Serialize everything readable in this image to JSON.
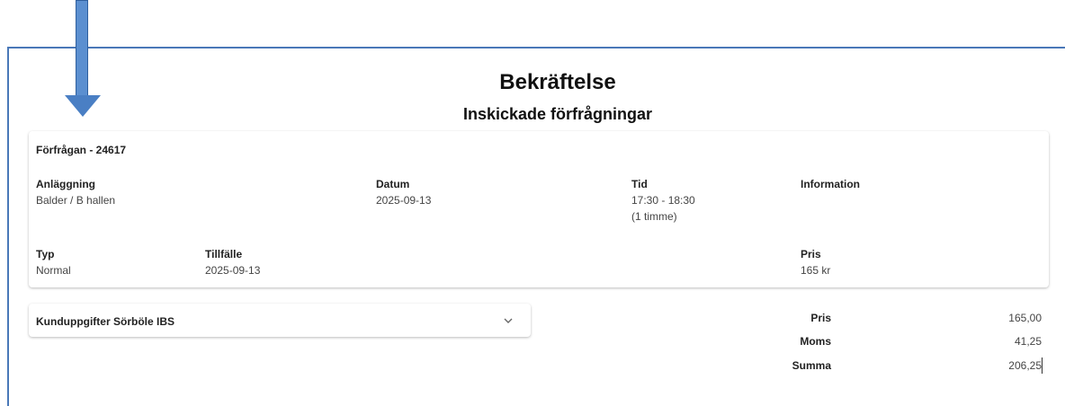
{
  "header": {
    "title": "Bekräftelse",
    "subtitle": "Inskickade förfrågningar"
  },
  "request": {
    "heading": "Förfrågan - 24617",
    "facility_label": "Anläggning",
    "facility_value": "Balder / B hallen",
    "date_label": "Datum",
    "date_value": "2025-09-13",
    "time_label": "Tid",
    "time_value": "17:30 - 18:30",
    "duration_value": "(1 timme)",
    "info_label": "Information",
    "type_label": "Typ",
    "type_value": "Normal",
    "occasion_label": "Tillfälle",
    "occasion_value": "2025-09-13",
    "price_label": "Pris",
    "price_value": "165 kr"
  },
  "customer": {
    "heading": "Kunduppgifter Sörböle IBS",
    "expand_icon": "chevron-down-icon"
  },
  "summary": {
    "price_label": "Pris",
    "price_value": "165,00",
    "vat_label": "Moms",
    "vat_value": "41,25",
    "total_label": "Summa",
    "total_value": "206,25"
  },
  "colors": {
    "arrow": "#5b8fd0",
    "frame": "#4a78b8"
  }
}
